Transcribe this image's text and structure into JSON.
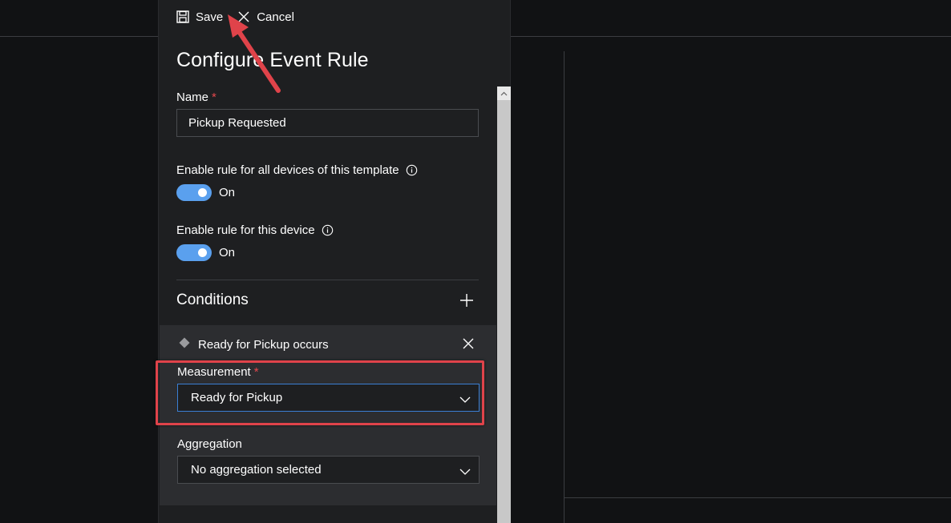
{
  "toolbar": {
    "save_label": "Save",
    "cancel_label": "Cancel"
  },
  "panel": {
    "title": "Configure Event Rule"
  },
  "name_field": {
    "label": "Name",
    "required_mark": "*",
    "value": "Pickup Requested"
  },
  "toggle_template": {
    "label": "Enable rule for all devices of this template",
    "state_text": "On",
    "enabled": true
  },
  "toggle_device": {
    "label": "Enable rule for this device",
    "state_text": "On",
    "enabled": true
  },
  "conditions": {
    "title": "Conditions",
    "items": [
      {
        "header": "Ready for Pickup occurs",
        "measurement_label": "Measurement",
        "measurement_required": "*",
        "measurement_value": "Ready for Pickup",
        "aggregation_label": "Aggregation",
        "aggregation_value": "No aggregation selected"
      }
    ]
  },
  "icons": [
    "save-icon",
    "close-icon",
    "info-icon",
    "plus-icon",
    "diamond-icon",
    "chevron-down-icon",
    "annotation-arrow"
  ],
  "colors": {
    "background": "#111214",
    "panel": "#1e1f21",
    "condition_box": "#2c2d30",
    "toggle_on": "#5aa0ee",
    "required": "#e5484d",
    "focus_border": "#3b7fd4",
    "annotation": "#e0434a"
  }
}
